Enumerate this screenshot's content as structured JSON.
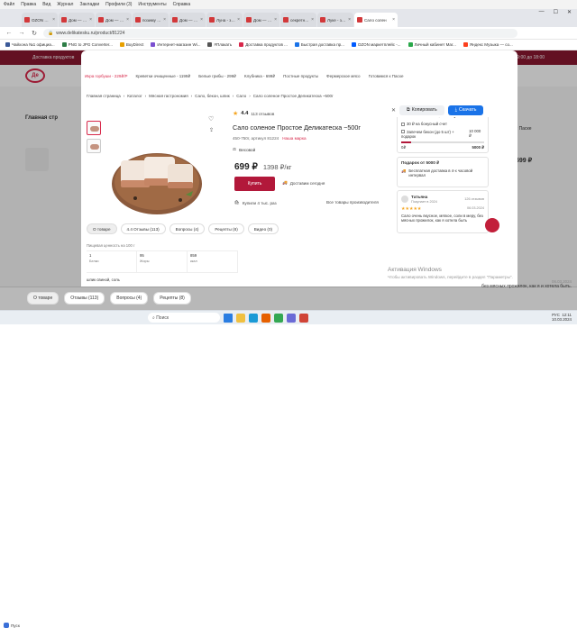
{
  "menubar": [
    "Файл",
    "Правка",
    "Вид",
    "Журнал",
    "Закладки",
    "Профили (3)",
    "Инструменты",
    "Справка"
  ],
  "tabs": [
    {
      "label": "OZON маркетпл",
      "active": false
    },
    {
      "label": "Дом — пое",
      "active": false
    },
    {
      "label": "Дом — пое",
      "active": false
    },
    {
      "label": "позиму любо",
      "active": false
    },
    {
      "label": "Дом — пое",
      "active": false
    },
    {
      "label": "Луна - запрет",
      "active": false
    },
    {
      "label": "Дом — пое",
      "active": false
    },
    {
      "label": "секретные ф",
      "active": false
    },
    {
      "label": "Луке - запрет",
      "active": false
    },
    {
      "label": "Сало солен",
      "active": true
    }
  ],
  "address": {
    "url": "www.delikatesku.ru/product/81224"
  },
  "bookmarks": [
    "Чайхона №1 официа...",
    "PNG to JPG Converter...",
    "BuyDirect",
    "Интернет-магазин Wi...",
    "#Плакать",
    "Доставка продуктов ...",
    "Быстрая доставка пр...",
    "OZON маркетплейс -...",
    "Личный кабинет Mar...",
    "Яндекс Музыка — со..."
  ],
  "bookmark_popup": {
    "copy": "Копировать",
    "download": "Скачать"
  },
  "background": {
    "topbar_left": "Доставка продуктов",
    "topbar_right": "с 9:00 до 18:00",
    "logo": "Де",
    "main_title": "Главная стр",
    "right_text": "к Паске",
    "right_price": "599 ₽",
    "bottom_review": "без мясных прожилок, как я и хотела быть.",
    "bottom_date": "06.03.2024"
  },
  "categories": [
    "Икра горбуши - 229₽/P",
    "Креветки очищенные - 1199₽",
    "Белые грибы - 299₽",
    "Клубника - 699₽",
    "Постные продукты",
    "Фермерское мясо",
    "Готовимся к Пасхе"
  ],
  "breadcrumbs": [
    "Главная страница",
    "Каталог",
    "Мясная гастрономия",
    "Сало, бекон, шпик",
    "Сало",
    "Сало соленое Простое Деликатеска ~500г"
  ],
  "product": {
    "title": "Сало соленое Простое Деликатеска ~500г",
    "rating": "4.4",
    "reviews": "113 отзывов",
    "meta": "450-750г, артикул 81224",
    "brand": "Наша марка",
    "weight": "Весовой",
    "price_now": "699 ₽",
    "price_per": "1398 ₽/кг",
    "buy": "Купить",
    "delivery": "Доставим сегодня",
    "bought": "Купили 4 тыс. раз",
    "all_products": "Все товары производителя"
  },
  "order_panel": {
    "heading": "Закажите на 5000 ₽ и получите",
    "row1": "30 ₽ на бонусный счет",
    "row2": "Запечем бекон (до 5 шт) + подарок",
    "row2_val": "10 000 ₽",
    "left": "0₽",
    "right": "5000 ₽",
    "progress": 0.12
  },
  "gift_panel": {
    "heading": "Подарок от 5000 ₽",
    "text": "Бесплатная доставка в 4-х часовой интервал"
  },
  "review_card": {
    "name": "Татьяна",
    "status": "Покупает в 2024",
    "count": "126 отзывов",
    "date": "06.03.2024",
    "text": "Сало очень вкусное, мягкое, соли в меру, без мясных прожилок, как я хотела быть"
  },
  "tabs_row": [
    "О товаре",
    "4.4 Отзывы (113)",
    "Вопросы (4)",
    "Рецепты (8)",
    "Видео (0)"
  ],
  "nutrition": {
    "caption": "Пищевая ценность на 100 г",
    "cells": [
      {
        "value": "1",
        "unit": "Белки"
      },
      {
        "value": "95",
        "unit": "Жиры"
      },
      {
        "value": "859",
        "unit": "ккал"
      }
    ],
    "composition": "шпик свиной, соль"
  },
  "bottom_tabs": [
    "О товаре",
    "Отзывы (113)",
    "Вопросы (4)",
    "Рецепты (8)"
  ],
  "watermark": {
    "title": "Активация Windows",
    "subtitle": "Чтобы активировать Windows, перейдите в раздел \"Параметры\"."
  },
  "taskbar": {
    "weather": "Пуск",
    "search": "Поиск",
    "time": "12:11",
    "date": "10.03.2024",
    "lang": "РУС"
  }
}
